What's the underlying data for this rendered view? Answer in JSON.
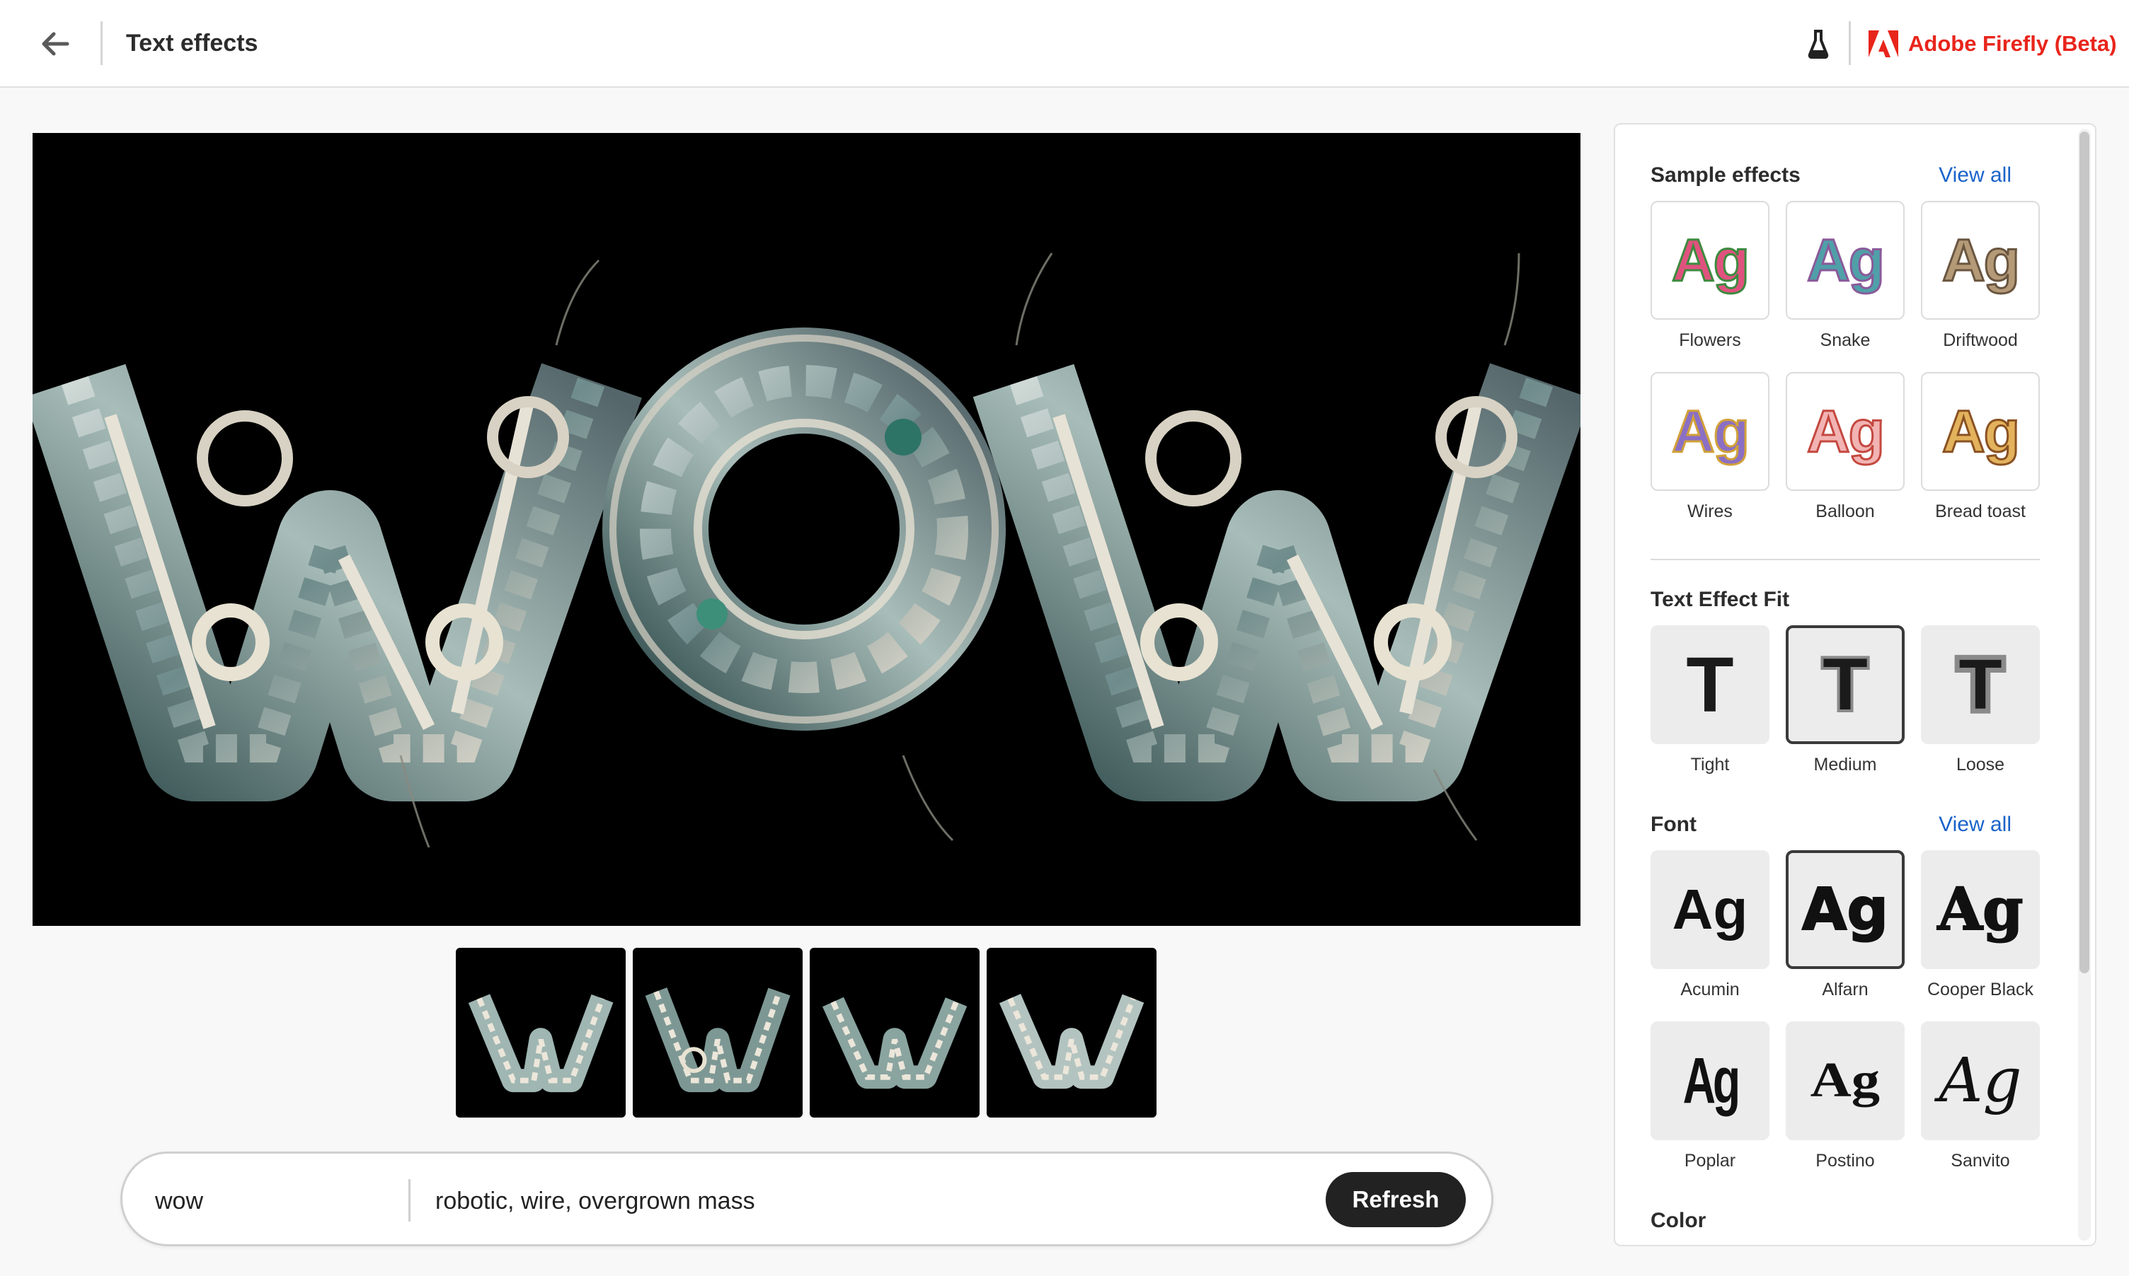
{
  "header": {
    "title": "Text effects",
    "brand": "Adobe Firefly (Beta)",
    "brand_color": "#e8251c"
  },
  "prompt": {
    "text_value": "wow",
    "prompt_value": "robotic, wire, overgrown mass",
    "refresh_label": "Refresh"
  },
  "main_image": {
    "text": "wow"
  },
  "thumbnails": [
    {
      "letter": "W",
      "selected": false
    },
    {
      "letter": "W",
      "selected": true
    },
    {
      "letter": "W",
      "selected": false
    },
    {
      "letter": "W",
      "selected": false
    }
  ],
  "panel": {
    "sample_effects": {
      "title": "Sample effects",
      "view_all": "View all",
      "items": [
        {
          "label": "Flowers",
          "glyph": "Ag"
        },
        {
          "label": "Snake",
          "glyph": "Ag"
        },
        {
          "label": "Driftwood",
          "glyph": "Ag"
        },
        {
          "label": "Wires",
          "glyph": "Ag"
        },
        {
          "label": "Balloon",
          "glyph": "Ag"
        },
        {
          "label": "Bread toast",
          "glyph": "Ag"
        }
      ]
    },
    "fit": {
      "title": "Text Effect Fit",
      "items": [
        {
          "label": "Tight",
          "glyph": "T"
        },
        {
          "label": "Medium",
          "glyph": "T"
        },
        {
          "label": "Loose",
          "glyph": "T"
        }
      ]
    },
    "font": {
      "title": "Font",
      "view_all": "View all",
      "items": [
        {
          "label": "Acumin",
          "glyph": "Ag"
        },
        {
          "label": "Alfarn",
          "glyph": "Ag"
        },
        {
          "label": "Cooper Black",
          "glyph": "Ag"
        },
        {
          "label": "Poplar",
          "glyph": "Ag"
        },
        {
          "label": "Postino",
          "glyph": "Ag"
        },
        {
          "label": "Sanvito",
          "glyph": "Ag"
        }
      ]
    },
    "color": {
      "title": "Color"
    }
  }
}
